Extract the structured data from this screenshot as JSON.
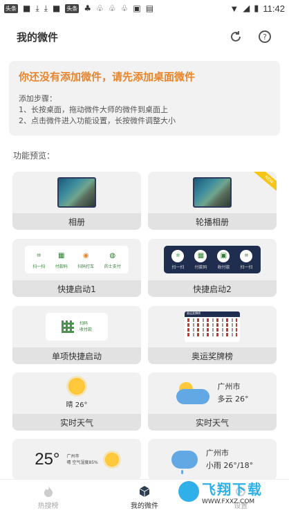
{
  "status_bar": {
    "chip1": "头条",
    "chip2": "头条",
    "time": "11:42"
  },
  "header": {
    "title": "我的微件"
  },
  "notice": {
    "title": "你还没有添加微件，请先添加桌面微件",
    "steps_title": "添加步骤：",
    "step1": "1、长按桌面，拖动微件大师的微件到桌面上",
    "step2": "2、点击微件进入功能设置，长按微件调整大小"
  },
  "section_label": "功能预览：",
  "cards": {
    "album": {
      "label": "相册"
    },
    "carousel": {
      "label": "轮播相册",
      "badge": "NEW"
    },
    "shortcut1": {
      "label": "快捷启动1",
      "items": [
        "扫一扫",
        "付款码",
        "扫码打车",
        "的士支付"
      ]
    },
    "shortcut2": {
      "label": "快捷启动2",
      "items": [
        "扫一扫",
        "付款码",
        "收付款",
        "扫一扫"
      ]
    },
    "single": {
      "label": "单项快捷启动",
      "line1": "扫码",
      "line2": "收付款"
    },
    "medals": {
      "label": "奥运奖牌榜",
      "head": "奥运奖牌榜"
    },
    "weather1": {
      "label": "实时天气",
      "text": "晴 26°"
    },
    "weather2": {
      "label": "实时天气",
      "city": "广州市",
      "cond": "多云 26°"
    },
    "weather3": {
      "temp": "25°",
      "city": "广州市",
      "desc": "晴 空气湿度85%"
    },
    "weather4": {
      "city": "广州市",
      "cond": "小雨 26°/18°"
    }
  },
  "bottom_nav": {
    "hot": "热搜榜",
    "mine": "我的微件",
    "settings": "设置"
  },
  "watermark": {
    "main": "飞翔下载",
    "sub": "WWW.FXXZ.COM"
  }
}
